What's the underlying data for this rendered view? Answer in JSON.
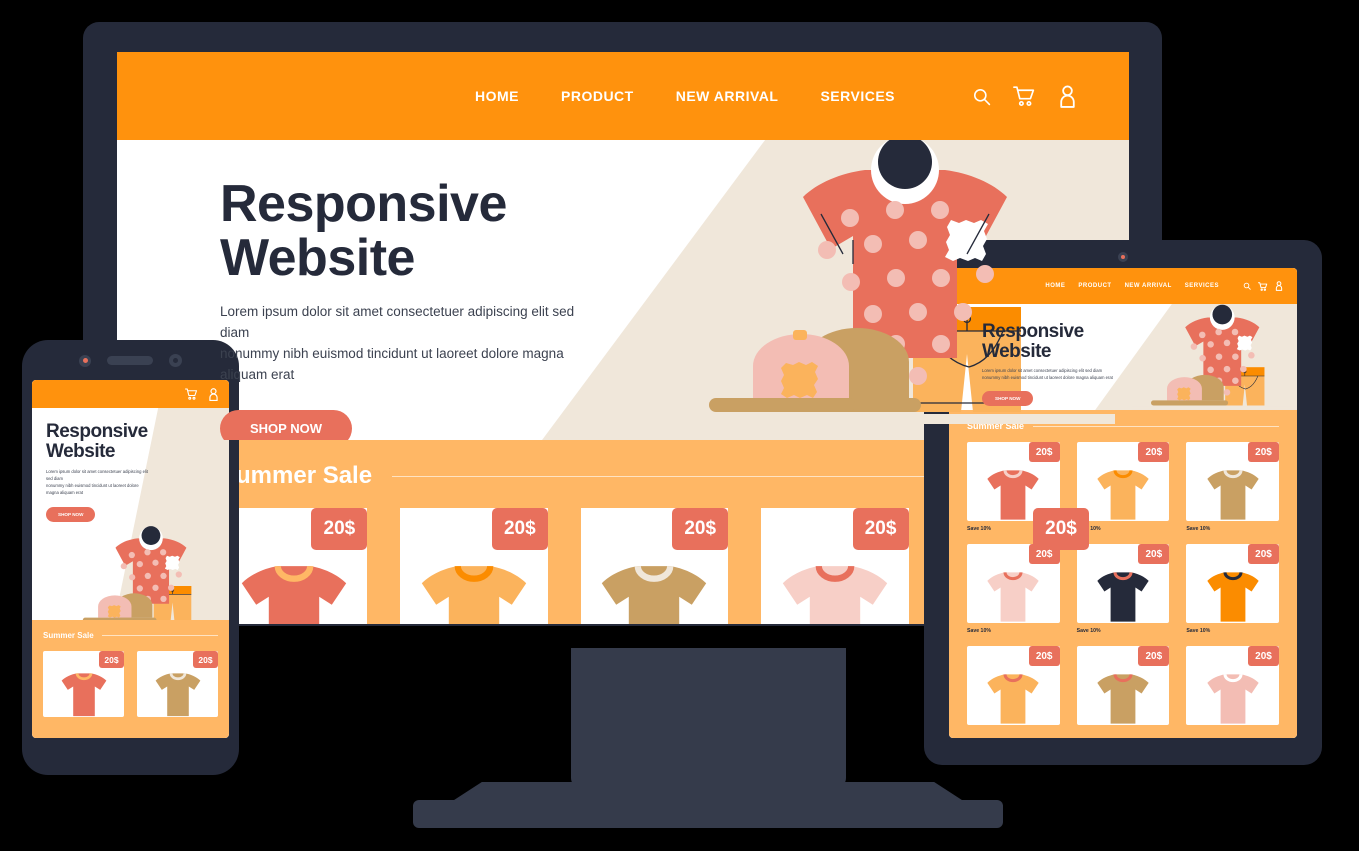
{
  "site": {
    "nav": {
      "links": [
        "HOME",
        "PRODUCT",
        "NEW ARRIVAL",
        "SERVICES"
      ],
      "icons": [
        "search-icon",
        "cart-icon",
        "user-icon"
      ]
    },
    "hero": {
      "title_line1": "Responsive",
      "title_line2": "Website",
      "paragraph_line1": "Lorem ipsum dolor sit amet consectetuer adipiscing elit sed diam",
      "paragraph_line2": "nonummy nibh euismod tincidunt ut laoreet dolore magna aliquam erat",
      "cta": "SHOP NOW"
    },
    "sale": {
      "title": "Summer Sale",
      "badge_price": "20$",
      "save_note": "Save 10%",
      "desktop_products": [
        {
          "color": "#E8705C",
          "collar": "#FFB765"
        },
        {
          "color": "#FBB35C",
          "collar": "#FB8C00"
        },
        {
          "color": "#C9A063",
          "collar": "#F0E7DA"
        },
        {
          "color": "#F7CFC7",
          "collar": "#E8705C"
        },
        {
          "color": "#252A3A",
          "collar": "#E8705C"
        }
      ],
      "tablet_products": [
        {
          "color": "#E8705C",
          "collar": "#F7CFC7",
          "note": "Save 10%"
        },
        {
          "color": "#FBB35C",
          "collar": "#FB8C00",
          "note": "Save 10%"
        },
        {
          "color": "#C9A063",
          "collar": "#F0E7DA",
          "note": "Save 10%"
        },
        {
          "color": "#F7CFC7",
          "collar": "#E8705C",
          "note": "Save 10%"
        },
        {
          "color": "#252A3A",
          "collar": "#E8705C",
          "note": "Save 10%"
        },
        {
          "color": "#FB8C00",
          "collar": "#252A3A",
          "note": "Save 10%"
        },
        {
          "color": "#FBB35C",
          "collar": "#E8705C",
          "note": ""
        },
        {
          "color": "#C9A063",
          "collar": "#E8705C",
          "note": ""
        },
        {
          "color": "#F3BDB4",
          "collar": "#FFFFFF",
          "note": ""
        }
      ],
      "phone_products": [
        {
          "color": "#E8705C",
          "collar": "#FFB765"
        },
        {
          "color": "#C9A063",
          "collar": "#F0E7DA"
        }
      ]
    }
  },
  "devices": {
    "monitor": "desktop-monitor",
    "tablet": "tablet-device",
    "phone": "phone-device"
  },
  "colors": {
    "background": "#000000",
    "device_frame": "#252A3A",
    "device_stand": "#353B4B",
    "nav_orange": "#FF920D",
    "sale_band": "#FFB765",
    "accent_coral": "#E8705C",
    "beige": "#F0E7DA",
    "text_dark": "#252A3A"
  }
}
